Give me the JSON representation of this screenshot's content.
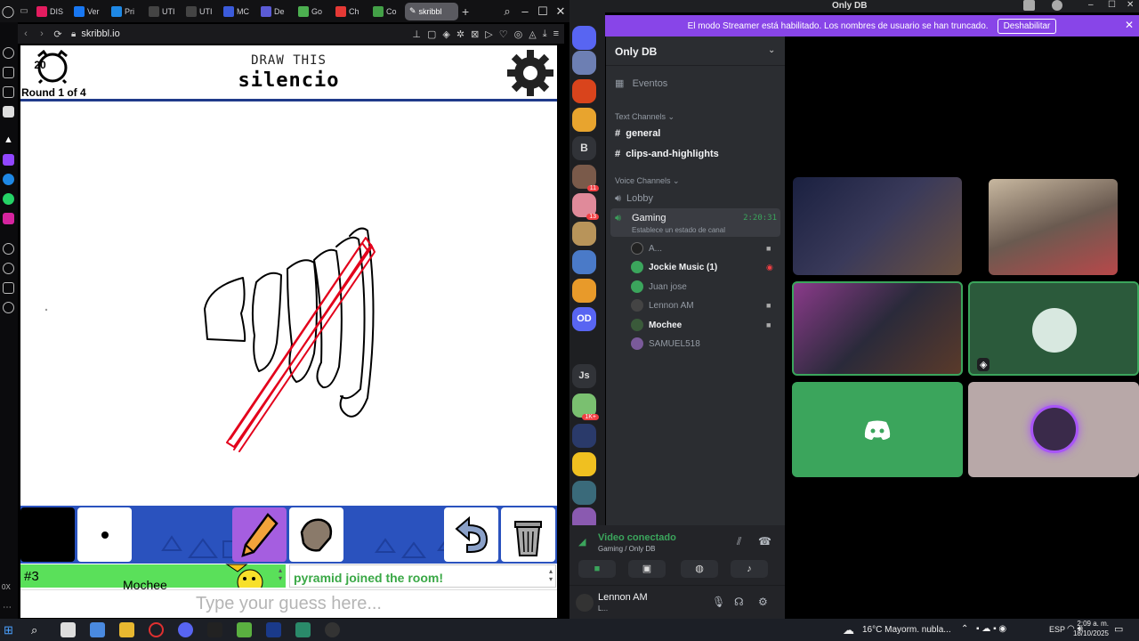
{
  "browser": {
    "tabs": [
      {
        "label": "DIS",
        "color": "#e31c5f"
      },
      {
        "label": "Ver",
        "color": "#1877f2"
      },
      {
        "label": "Pri",
        "color": "#1e88e5"
      },
      {
        "label": "UTI",
        "color": "#444"
      },
      {
        "label": "UTI",
        "color": "#444"
      },
      {
        "label": "MC",
        "color": "#3b5bdb"
      },
      {
        "label": "De",
        "color": "#5b5bd6"
      },
      {
        "label": "Go",
        "color": "#4caf50"
      },
      {
        "label": "Ch",
        "color": "#e53935"
      },
      {
        "label": "Co",
        "color": "#43a047"
      }
    ],
    "active_tab": "skribbl",
    "url": "skribbl.io"
  },
  "game": {
    "timer": "20",
    "round": "Round 1 of 4",
    "draw_this": "DRAW THIS",
    "word": "silencio",
    "player_rank": "#3",
    "player_name": "Mochee",
    "chat_message": "pyramid joined the room!",
    "guess_placeholder": "Type your guess here..."
  },
  "discord": {
    "title": "Only DB",
    "streamer_notice": "El modo Streamer está habilitado. Los nombres de usuario se han truncado.",
    "streamer_button": "Deshabilitar",
    "server_name": "Only DB",
    "events": "Eventos",
    "text_channels_header": "Text Channels",
    "text_channels": [
      "general",
      "clips-and-highlights"
    ],
    "voice_channels_header": "Voice Channels",
    "voice_channels": [
      "Lobby",
      "Gaming"
    ],
    "gaming_timer": "2:20:31",
    "gaming_status": "Establece un estado de canal",
    "voice_users": [
      "A...",
      "Jockie Music (1)",
      "Juan jose",
      "Lennon AM",
      "Mochee",
      "SAMUEL518"
    ],
    "guild_letters": [
      "B",
      "OD",
      "Js"
    ],
    "guild_badges": [
      "11",
      "13",
      "1K+"
    ],
    "voice_connected": "Video conectado",
    "voice_location": "Gaming / Only DB",
    "user_name": "Lennon AM",
    "user_status": "L..."
  },
  "taskbar": {
    "weather": "16°C  Mayorm. nubla...",
    "lang": "ESP",
    "time": "2:09 a. m.",
    "date": "18/10/2025",
    "zoom": "0X"
  },
  "colors": {
    "discord_green": "#3ba55c",
    "streamer_purple": "#8845e8",
    "skribbl_blue": "#2a52be",
    "drawing_red": "#e3001b"
  }
}
